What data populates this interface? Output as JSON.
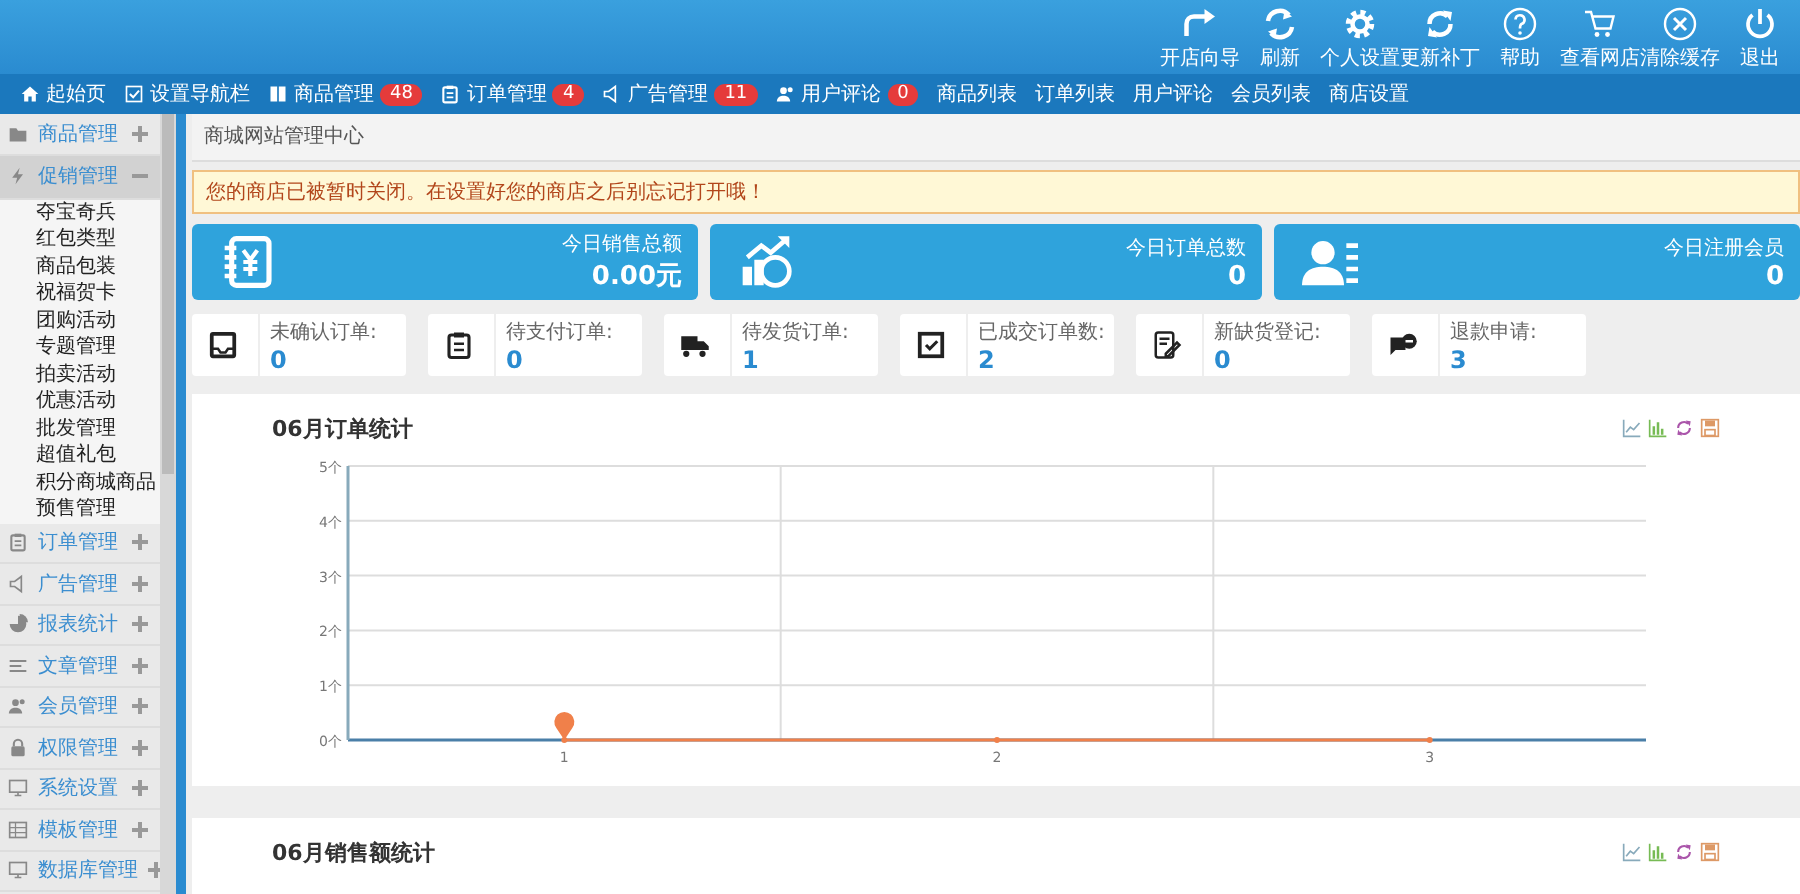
{
  "header": {
    "tools": [
      {
        "label": "开店向导"
      },
      {
        "label": "刷新"
      },
      {
        "label": "个人设置"
      },
      {
        "label": "更新补丁"
      },
      {
        "label": "帮助"
      },
      {
        "label": "查看网店"
      },
      {
        "label": "清除缓存"
      },
      {
        "label": "退出"
      }
    ]
  },
  "nav": [
    {
      "label": "起始页"
    },
    {
      "label": "设置导航栏"
    },
    {
      "label": "商品管理",
      "badge": "48"
    },
    {
      "label": "订单管理",
      "badge": "4"
    },
    {
      "label": "广告管理",
      "badge": "11"
    },
    {
      "label": "用户评论",
      "badge": "0"
    },
    {
      "label": "商品列表"
    },
    {
      "label": "订单列表"
    },
    {
      "label": "用户评论"
    },
    {
      "label": "会员列表"
    },
    {
      "label": "商店设置"
    }
  ],
  "sidebar": [
    {
      "label": "商品管理",
      "expanded": false
    },
    {
      "label": "促销管理",
      "expanded": true,
      "children": [
        {
          "label": "夺宝奇兵"
        },
        {
          "label": "红包类型"
        },
        {
          "label": "商品包装"
        },
        {
          "label": "祝福贺卡"
        },
        {
          "label": "团购活动"
        },
        {
          "label": "专题管理"
        },
        {
          "label": "拍卖活动"
        },
        {
          "label": "优惠活动"
        },
        {
          "label": "批发管理"
        },
        {
          "label": "超值礼包"
        },
        {
          "label": "积分商城商品"
        },
        {
          "label": "预售管理"
        }
      ]
    },
    {
      "label": "订单管理",
      "expanded": false
    },
    {
      "label": "广告管理",
      "expanded": false
    },
    {
      "label": "报表统计",
      "expanded": false
    },
    {
      "label": "文章管理",
      "expanded": false
    },
    {
      "label": "会员管理",
      "expanded": false
    },
    {
      "label": "权限管理",
      "expanded": false
    },
    {
      "label": "系统设置",
      "expanded": false
    },
    {
      "label": "模板管理",
      "expanded": false
    },
    {
      "label": "数据库管理",
      "expanded": false
    }
  ],
  "breadcrumb": "商城网站管理中心",
  "notice": "您的商店已被暂时关闭。在设置好您的商店之后别忘记打开哦！",
  "summary": [
    {
      "label": "今日销售总额",
      "value": "0.00元"
    },
    {
      "label": "今日订单总数",
      "value": "0"
    },
    {
      "label": "今日注册会员",
      "value": "0"
    }
  ],
  "counters": [
    {
      "label": "未确认订单:",
      "value": "0"
    },
    {
      "label": "待支付订单:",
      "value": "0"
    },
    {
      "label": "待发货订单:",
      "value": "1"
    },
    {
      "label": "已成交订单数:",
      "value": "2"
    },
    {
      "label": "新缺货登记:",
      "value": "0"
    },
    {
      "label": "退款申请:",
      "value": "3"
    }
  ],
  "order_chart": {
    "chart_data": {
      "type": "line",
      "title": "06月订单统计",
      "categories": [
        "1",
        "2",
        "3"
      ],
      "series": [
        {
          "color": "#f0804a",
          "values": [
            0,
            0,
            0
          ],
          "marker": true
        }
      ],
      "grid": true,
      "ylim": [
        0,
        5
      ],
      "yticks": [
        {
          "value": 0,
          "label": "0个"
        },
        {
          "value": 1,
          "label": "1个"
        },
        {
          "value": 2,
          "label": "2个"
        },
        {
          "value": 3,
          "label": "3个"
        },
        {
          "value": 4,
          "label": "4个"
        },
        {
          "value": 5,
          "label": "5个"
        }
      ]
    }
  },
  "sales_chart": {
    "title": "06月销售额统计"
  }
}
